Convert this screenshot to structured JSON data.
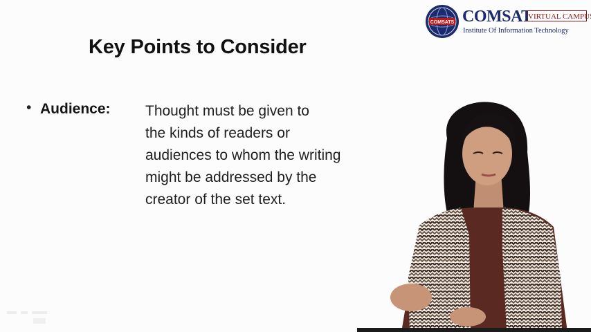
{
  "logo": {
    "name": "COMSATS",
    "emblem_text": "COMSATS",
    "campus": "VIRTUAL CAMPUS",
    "subtitle": "Institute Of Information Technology",
    "colors": {
      "navy": "#1a2a6a",
      "maroon": "#8a1212"
    }
  },
  "slide": {
    "title": "Key Points to Consider",
    "bullets": [
      {
        "marker": "•",
        "term": "Audience:",
        "lines": [
          "Thought must be given to",
          "the kinds of readers or",
          "audiences to whom the writing",
          "might be addressed by the",
          "creator of the set text."
        ]
      }
    ]
  },
  "presenter": {
    "icon": "presenter-video-feed"
  }
}
